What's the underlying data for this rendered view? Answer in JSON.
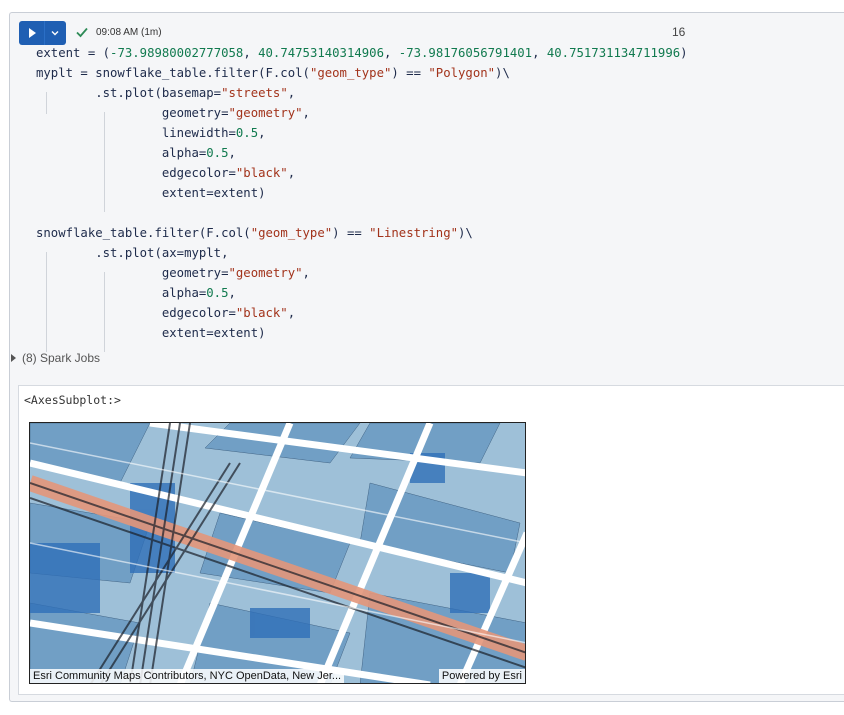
{
  "toolbar": {
    "status_time": "09:08 AM (1m)",
    "cell_number": "16"
  },
  "code_lines": [
    [
      {
        "t": "extent = ("
      },
      {
        "t": "-73.98980002777058",
        "c": "num"
      },
      {
        "t": ", "
      },
      {
        "t": "40.74753140314906",
        "c": "num"
      },
      {
        "t": ", "
      },
      {
        "t": "-73.98176056791401",
        "c": "num"
      },
      {
        "t": ", "
      },
      {
        "t": "40.751731134711996",
        "c": "num"
      },
      {
        "t": ")"
      }
    ],
    [
      {
        "t": "myplt = snowflake_table.filter(F.col("
      },
      {
        "t": "\"geom_type\"",
        "c": "str"
      },
      {
        "t": ") == "
      },
      {
        "t": "\"Polygon\"",
        "c": "str"
      },
      {
        "t": ")\\"
      }
    ],
    [
      {
        "t": "        .st.plot(basemap="
      },
      {
        "t": "\"streets\"",
        "c": "str"
      },
      {
        "t": ","
      }
    ],
    [
      {
        "t": "                 geometry="
      },
      {
        "t": "\"geometry\"",
        "c": "str"
      },
      {
        "t": ","
      }
    ],
    [
      {
        "t": "                 linewidth="
      },
      {
        "t": "0.5",
        "c": "num"
      },
      {
        "t": ","
      }
    ],
    [
      {
        "t": "                 alpha="
      },
      {
        "t": "0.5",
        "c": "num"
      },
      {
        "t": ","
      }
    ],
    [
      {
        "t": "                 edgecolor="
      },
      {
        "t": "\"black\"",
        "c": "str"
      },
      {
        "t": ","
      }
    ],
    [
      {
        "t": "                 extent=extent)"
      }
    ],
    [
      {
        "t": ""
      }
    ],
    [
      {
        "t": "snowflake_table.filter(F.col("
      },
      {
        "t": "\"geom_type\"",
        "c": "str"
      },
      {
        "t": ") == "
      },
      {
        "t": "\"Linestring\"",
        "c": "str"
      },
      {
        "t": ")\\"
      }
    ],
    [
      {
        "t": "        .st.plot(ax=myplt,"
      }
    ],
    [
      {
        "t": "                 geometry="
      },
      {
        "t": "\"geometry\"",
        "c": "str"
      },
      {
        "t": ","
      }
    ],
    [
      {
        "t": "                 alpha="
      },
      {
        "t": "0.5",
        "c": "num"
      },
      {
        "t": ","
      }
    ],
    [
      {
        "t": "                 edgecolor="
      },
      {
        "t": "\"black\"",
        "c": "str"
      },
      {
        "t": ","
      }
    ],
    [
      {
        "t": "                 extent=extent)"
      }
    ]
  ],
  "spark_jobs_label": "(8) Spark Jobs",
  "output_text": "<AxesSubplot:>",
  "map": {
    "attribution_left": "Esri Community Maps Contributors, NYC OpenData, New Jer...",
    "attribution_right": "Powered by Esri",
    "colors": {
      "water_fill": "#9ec0d8",
      "building_fill": "#6f9ec4",
      "street": "#ffffff",
      "highlight_road": "#e3967a",
      "line": "#1a1f28"
    }
  },
  "colors": {
    "run_button": "#1f5fb3",
    "check": "#2e8b57",
    "string": "#a2331b",
    "number": "#117a4f"
  }
}
